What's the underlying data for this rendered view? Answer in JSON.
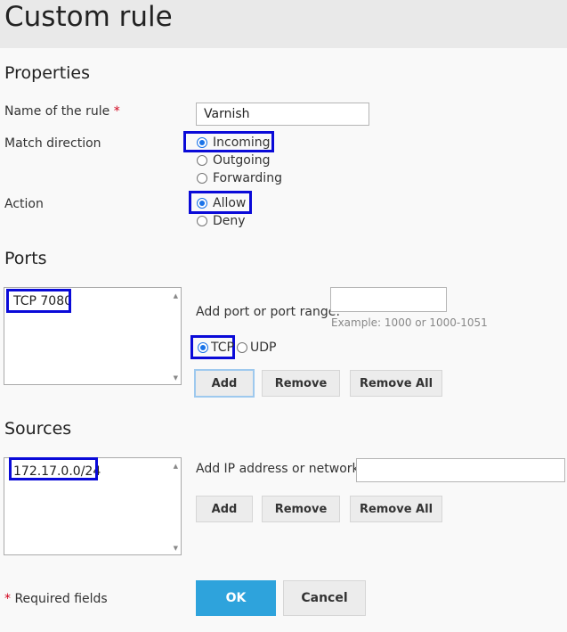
{
  "page": {
    "title": "Custom rule"
  },
  "properties": {
    "section_title": "Properties",
    "name_label": "Name of the rule",
    "required_mark": "*",
    "name_value": "Varnish",
    "direction_label": "Match direction",
    "direction_options": [
      "Incoming",
      "Outgoing",
      "Forwarding"
    ],
    "direction_selected": "Incoming",
    "action_label": "Action",
    "action_options": [
      "Allow",
      "Deny"
    ],
    "action_selected": "Allow"
  },
  "ports": {
    "section_title": "Ports",
    "items": [
      "TCP 7080"
    ],
    "add_label": "Add port or port range:",
    "input_value": "",
    "example": "Example: 1000 or 1000-1051",
    "protocol_options": [
      "TCP",
      "UDP"
    ],
    "protocol_selected": "TCP",
    "add_button": "Add",
    "remove_button": "Remove",
    "remove_all_button": "Remove All"
  },
  "sources": {
    "section_title": "Sources",
    "items": [
      "172.17.0.0/24"
    ],
    "add_label": "Add IP address or network:",
    "input_value": "",
    "add_button": "Add",
    "remove_button": "Remove",
    "remove_all_button": "Remove All"
  },
  "footer": {
    "required_mark": "*",
    "required_text": " Required fields",
    "ok_button": "OK",
    "cancel_button": "Cancel"
  },
  "colors": {
    "highlight": "#0a0ad8",
    "primary": "#2ea3dc",
    "radio_checked": "#1a73e8",
    "required": "#d0021b"
  }
}
